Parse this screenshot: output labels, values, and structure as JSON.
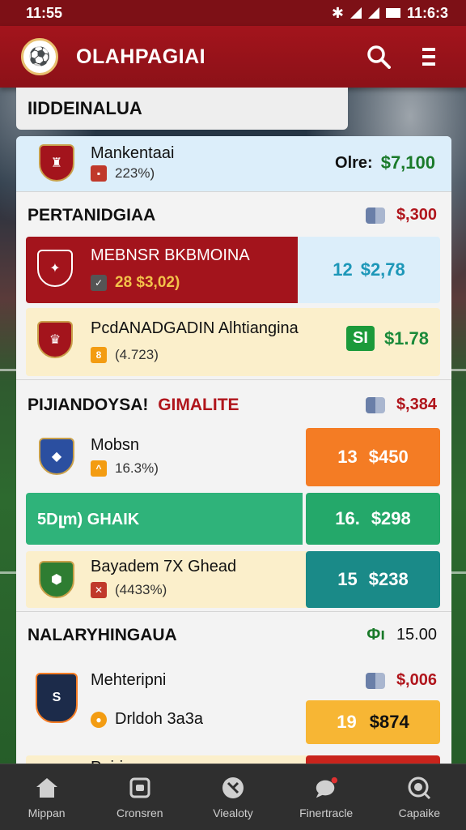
{
  "status_bar": {
    "time_left": "11:55",
    "time_right": "11:6:3"
  },
  "app_bar": {
    "title": "OLAHPAGIAI",
    "logo_glyph": "⚽",
    "search_icon": "search-icon",
    "menu_icon": "menu-icon"
  },
  "top_header": {
    "title": "IIDDEINALUA"
  },
  "featured": {
    "team": "Mankentaai",
    "sub": "22",
    "sub_pct": "223%)",
    "odds_label": "Olre:",
    "odds_value": "$7,100",
    "crest_color": "#b0151c"
  },
  "section1": {
    "title": "PERTANIDGIAA",
    "value": "$,300",
    "rows": [
      {
        "team": "MEBNSR BKBMOINA",
        "sub": "28 $3,02)",
        "odds_num": "12",
        "odds_val": "$2,78",
        "band_color": "#a3141c",
        "odds_bg": "#dceefa",
        "odds_fg": "#1d97b8",
        "crest": "#a3141c"
      },
      {
        "team": "PcdANADGADIN Alhtiangina",
        "sub": "(4.723)",
        "badge": "SI",
        "odds_val": "$1.78",
        "band_color": "#fbefcb",
        "odds_bg": "#fbefcb",
        "odds_fg": "#1b8a3a",
        "crest": "#a3141c"
      }
    ]
  },
  "section2": {
    "title_a": "PIJIANDOYSA!",
    "title_b": "GIMALITE",
    "value": "$,384",
    "rows": [
      {
        "team": "Mobsn",
        "sub": "16.3%)",
        "odds_num": "13",
        "odds_val": "$450",
        "odds_bg": "#f47c24"
      },
      {
        "team": "5Dլm) GHAIK",
        "odds_num": "16.",
        "odds_val": "$298",
        "odds_bg": "#24a86a",
        "band_color": "#2fb37a"
      },
      {
        "team": "Bayadem 7X Ghead",
        "sub": "(4433%)",
        "odds_num": "15",
        "odds_val": "$238",
        "odds_bg": "#1a8a88"
      }
    ]
  },
  "section3": {
    "title": "NALARYHINGAUA",
    "value_icon": "Фı",
    "value": "15.00",
    "rows": [
      {
        "team": "Mehteripni",
        "extra": "$,006"
      },
      {
        "team": "Drldoh 3a3a",
        "odds_num": "19",
        "odds_val": "$874",
        "odds_bg": "#f7b634"
      },
      {
        "team": "Pairiann"
      }
    ]
  },
  "nav": {
    "items": [
      {
        "label": "Mippan",
        "icon": "home-icon"
      },
      {
        "label": "Cronsren",
        "icon": "calendar-icon"
      },
      {
        "label": "Viealoty",
        "icon": "soccer-ball-icon"
      },
      {
        "label": "Finertracle",
        "icon": "chat-icon"
      },
      {
        "label": "Capaike",
        "icon": "profile-icon"
      }
    ]
  }
}
